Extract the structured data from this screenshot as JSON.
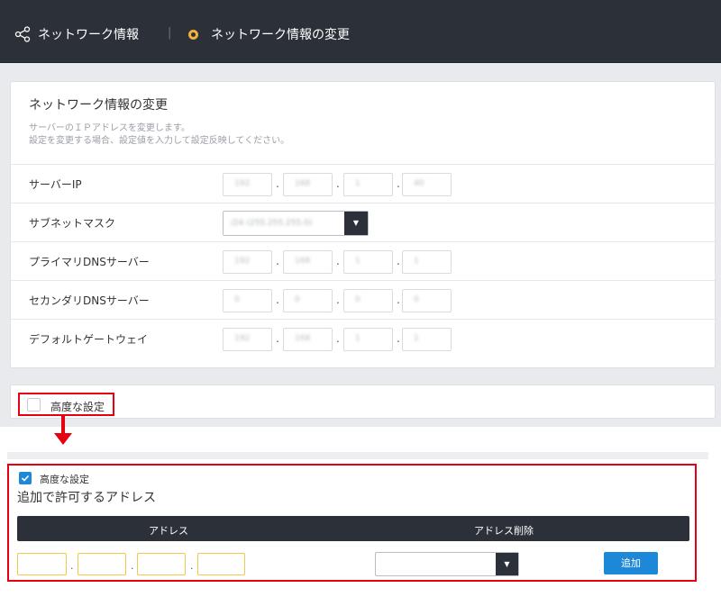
{
  "header": {
    "breadcrumb_parent": "ネットワーク情報",
    "breadcrumb_separator": "|",
    "breadcrumb_current": "ネットワーク情報の変更"
  },
  "card": {
    "title": "ネットワーク情報の変更",
    "desc_line1": "サーバーのＩＰアドレスを変更します。",
    "desc_line2": "設定を変更する場合、設定値を入力して設定反映してください。",
    "rows": [
      {
        "label": "サーバーIP",
        "type": "ip",
        "values": [
          "192",
          "168",
          "1",
          "40"
        ]
      },
      {
        "label": "サブネットマスク",
        "type": "select",
        "value": "/24 (255.255.255.0)"
      },
      {
        "label": "プライマリDNSサーバー",
        "type": "ip",
        "values": [
          "192",
          "168",
          "1",
          "1"
        ]
      },
      {
        "label": "セカンダリDNSサーバー",
        "type": "ip",
        "values": [
          "0",
          "0",
          "0",
          "0"
        ]
      },
      {
        "label": "デフォルトゲートウェイ",
        "type": "ip",
        "values": [
          "192",
          "168",
          "1",
          "1"
        ]
      }
    ]
  },
  "advanced": {
    "label": "高度な設定",
    "checked": false
  },
  "expanded": {
    "advanced_label": "高度な設定",
    "checked": true,
    "title": "追加で許可するアドレス",
    "col_address": "アドレス",
    "col_delete": "アドレス削除",
    "add_label": "追加",
    "address_values": [
      "",
      "",
      "",
      ""
    ],
    "delete_select_value": ""
  },
  "colors": {
    "header_bg": "#2c3038",
    "accent_dot": "#f0b23a",
    "highlight_red": "#e60012",
    "primary_blue": "#1e88d8",
    "input_yellow": "#f3c84a"
  }
}
